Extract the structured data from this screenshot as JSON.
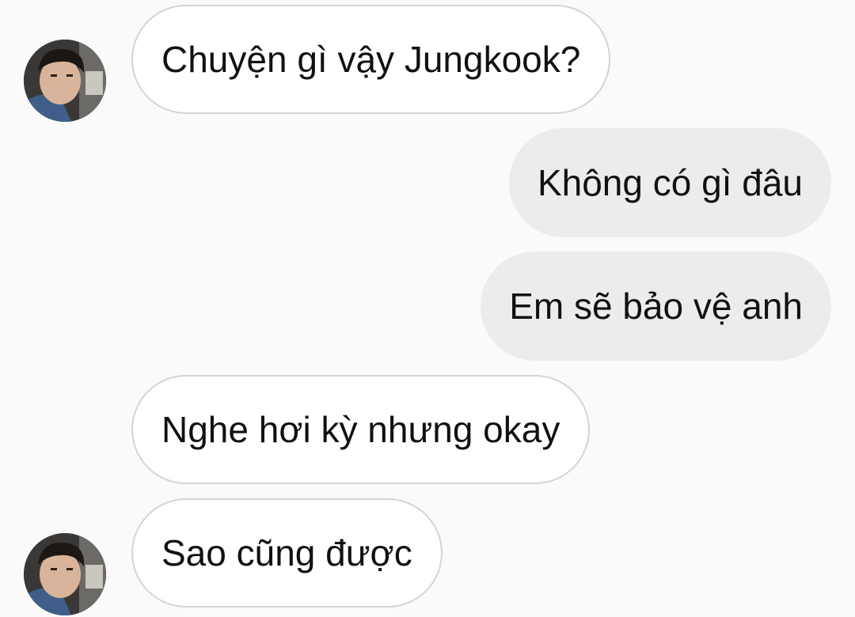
{
  "conversation": {
    "messages": [
      {
        "direction": "received",
        "text": "Chuyện gì vậy Jungkook?",
        "show_avatar": true
      },
      {
        "direction": "sent",
        "text": "Không có gì đâu"
      },
      {
        "direction": "sent",
        "text": "Em sẽ bảo vệ anh"
      },
      {
        "direction": "received",
        "text": "Nghe hơi kỳ nhưng okay",
        "show_avatar": false
      },
      {
        "direction": "received",
        "text": "Sao cũng được",
        "show_avatar": true
      }
    ]
  },
  "colors": {
    "background": "#fafafa",
    "received_bubble": "#ffffff",
    "received_border": "#d4d4d4",
    "sent_bubble": "#ececec",
    "text": "#111111"
  },
  "icons": {
    "avatar": "contact-avatar-photo"
  }
}
